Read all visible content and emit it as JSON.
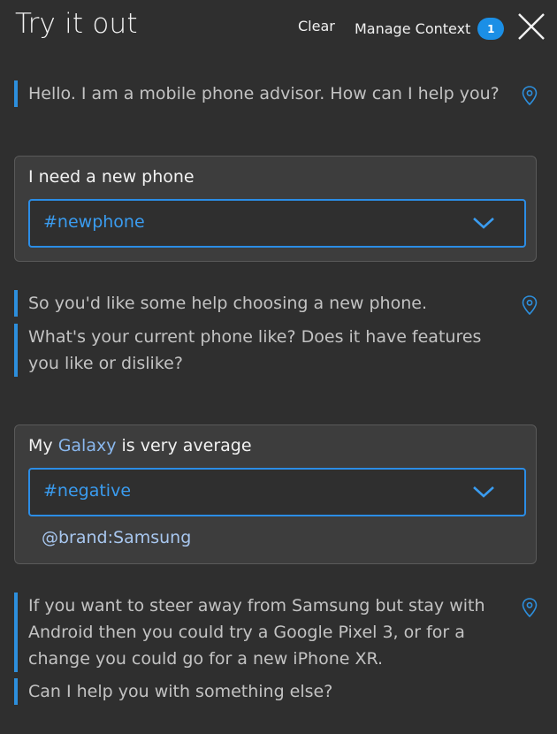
{
  "header": {
    "title": "Try it out",
    "clear_label": "Clear",
    "context_label": "Manage Context",
    "context_count": "1"
  },
  "messages": {
    "bot1": "Hello. I am a mobile phone advisor. How can I help you?",
    "user1": {
      "text": "I need a new phone",
      "intent": "#newphone"
    },
    "bot2_line1": "So you'd like some help choosing a new phone.",
    "bot2_line2_a": "What's your current phone like? Does it have features",
    "bot2_line2_b": "you like or dislike?",
    "user2": {
      "text_before": "My ",
      "entity_text": "Galaxy",
      "text_after": " is very average",
      "intent": "#negative",
      "entity": "@brand:Samsung"
    },
    "bot3_line1_a": "If you want to steer away from Samsung but stay with",
    "bot3_line1_b": "Android then you could try a Google Pixel 3, or for a",
    "bot3_line1_c": "change you could go for a new iPhone XR.",
    "bot3_line2": "Can I help you with something else?"
  },
  "colors": {
    "accent": "#1b8fe6",
    "intent_text": "#3a9cf0",
    "entity_text": "#a8c7ef",
    "background": "#2f2f2f",
    "card_background": "#3d3d3d"
  },
  "icons": {
    "close": "close-icon",
    "location": "location-pin-icon",
    "dropdown": "chevron-down-icon"
  }
}
